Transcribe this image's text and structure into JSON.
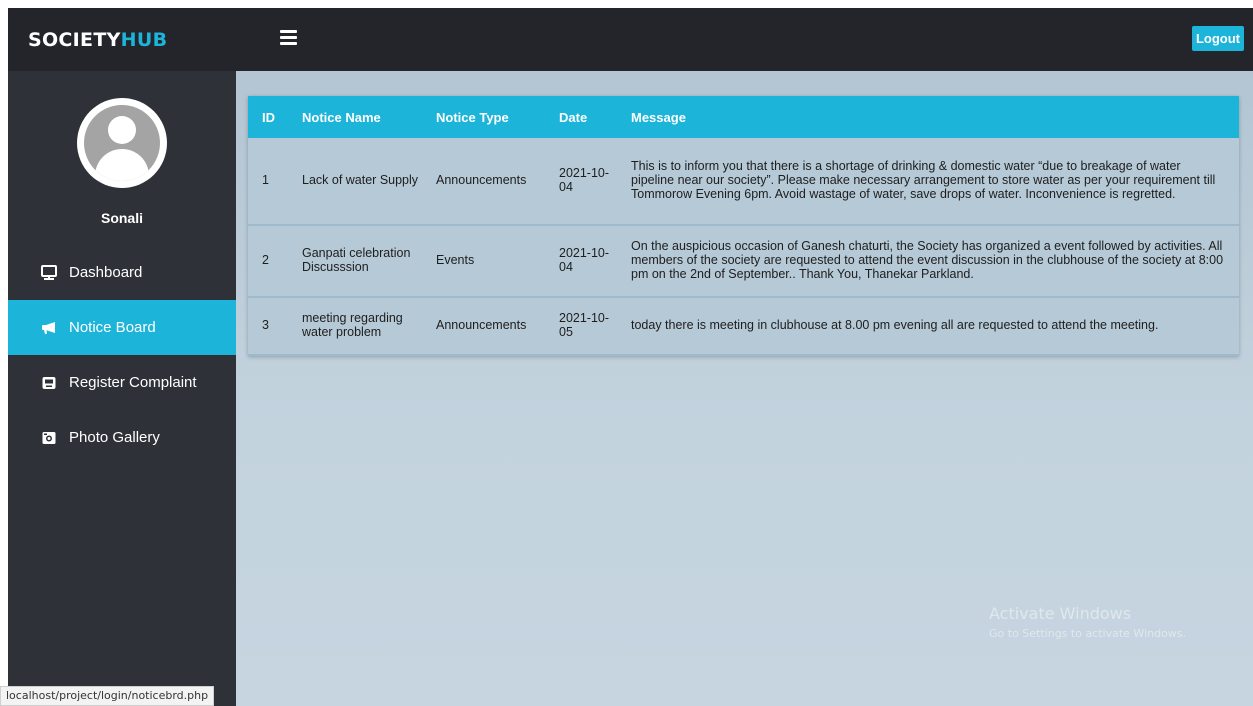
{
  "header": {
    "brand_society": "SOCIETY",
    "brand_hub": "HUB",
    "logout_label": "Logout"
  },
  "sidebar": {
    "username": "Sonali",
    "items": [
      {
        "label": "Dashboard",
        "icon": "monitor-icon",
        "active": false
      },
      {
        "label": "Notice Board",
        "icon": "bullhorn-icon",
        "active": true
      },
      {
        "label": "Register Complaint",
        "icon": "inbox-icon",
        "active": false
      },
      {
        "label": "Photo Gallery",
        "icon": "camera-icon",
        "active": false
      }
    ]
  },
  "table": {
    "headers": [
      "ID",
      "Notice Name",
      "Notice Type",
      "Date",
      "Message"
    ],
    "rows": [
      {
        "id": "1",
        "name": "Lack of water Supply",
        "type": "Announcements",
        "date": "2021-10-04",
        "message": "This is to inform you that there is a shortage of drinking & domestic water “due to breakage of water pipeline near our society”. Please make necessary arrangement to store water as per your requirement till Tommorow Evening 6pm. Avoid wastage of water, save drops of water. Inconvenience is regretted."
      },
      {
        "id": "2",
        "name": "Ganpati celebration Discusssion",
        "type": "Events",
        "date": "2021-10-04",
        "message": "On the auspicious occasion of Ganesh chaturti, the Society has organized a event followed by activities. All members of the society are requested to attend the event discussion in the clubhouse of the society at 8:00 pm on the 2nd of September.. Thank You, Thanekar Parkland."
      },
      {
        "id": "3",
        "name": "meeting regarding water problem",
        "type": "Announcements",
        "date": "2021-10-05",
        "message": "today there is meeting in clubhouse at 8.00 pm evening all are requested to attend the meeting."
      }
    ]
  },
  "watermark": {
    "title": "Activate Windows",
    "subtitle": "Go to Settings to activate Windows."
  },
  "status_bar": {
    "url": "localhost/project/login/noticebrd.php"
  },
  "colors": {
    "accent": "#1cb4d9",
    "header_bg": "#23252b",
    "sidebar_bg": "#2e3138"
  }
}
